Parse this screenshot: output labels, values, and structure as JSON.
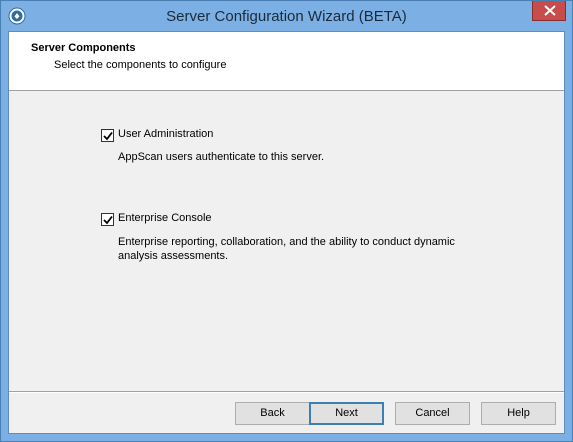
{
  "window": {
    "title": "Server Configuration Wizard (BETA)"
  },
  "header": {
    "title": "Server Components",
    "subtitle": "Select the components to configure"
  },
  "options": [
    {
      "label": "User Administration",
      "checked": true,
      "description": "AppScan users authenticate to this server."
    },
    {
      "label": "Enterprise Console",
      "checked": true,
      "description": "Enterprise reporting, collaboration, and the ability to conduct dynamic analysis assessments."
    }
  ],
  "buttons": {
    "back": "Back",
    "next": "Next",
    "cancel": "Cancel",
    "help": "Help"
  },
  "colors": {
    "title_bar": "#7cb0e4",
    "close_button": "#c74d4d",
    "client_background": "#f0f0f0"
  },
  "icons": {
    "app": "appscan-logo-icon",
    "close": "close-icon",
    "check": "checkmark-icon"
  }
}
